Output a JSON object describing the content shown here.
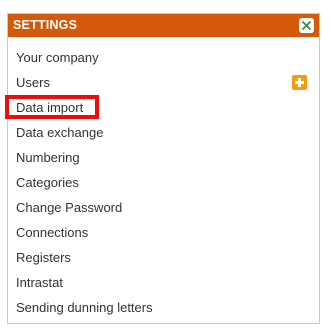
{
  "panel": {
    "title": "SETTINGS",
    "close_icon": "close-icon"
  },
  "menu": {
    "items": [
      {
        "label": "Your company"
      },
      {
        "label": "Users",
        "action_icon": "plus-icon"
      },
      {
        "label": "Data import",
        "highlighted": true
      },
      {
        "label": "Data exchange"
      },
      {
        "label": "Numbering"
      },
      {
        "label": "Categories"
      },
      {
        "label": "Change Password"
      },
      {
        "label": "Connections"
      },
      {
        "label": "Registers"
      },
      {
        "label": "Intrastat"
      },
      {
        "label": "Sending dunning letters"
      }
    ]
  },
  "colors": {
    "header_bg": "#d4590b",
    "highlight": "#ee0d0d",
    "add_button": "#f39c12"
  }
}
